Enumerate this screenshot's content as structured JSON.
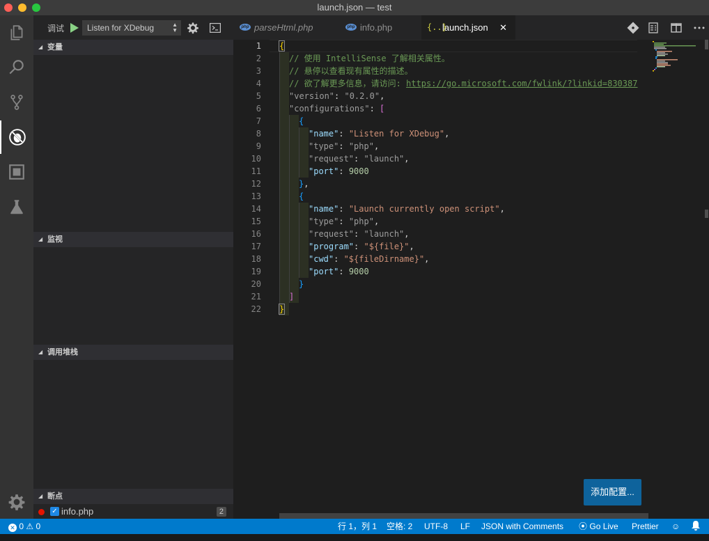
{
  "window": {
    "title": "launch.json — test"
  },
  "activity_bar": {
    "items": [
      "files-icon",
      "search-icon",
      "source-control-icon",
      "debug-icon",
      "extensions-icon",
      "test-flask-icon"
    ],
    "active": "debug-icon",
    "bottom": "gear-icon"
  },
  "sidebar": {
    "debug_label": "调试",
    "configuration": "Listen for XDebug",
    "sections": {
      "variables": "变量",
      "watch": "监视",
      "call_stack": "调用堆栈",
      "breakpoints": "断点"
    },
    "breakpoints": [
      {
        "file": "info.php",
        "count": "2",
        "enabled": true
      }
    ]
  },
  "tabs": [
    {
      "label": "parseHtml.php",
      "icon": "php-icon",
      "active": false
    },
    {
      "label": "info.php",
      "icon": "php-icon",
      "active": false
    },
    {
      "label": "launch.json",
      "icon": "json-braces-icon",
      "active": true
    }
  ],
  "tab_actions": [
    "open-changes-icon",
    "open-preview-icon",
    "split-editor-icon",
    "more-actions-icon"
  ],
  "editor": {
    "line_numbers": [
      "1",
      "2",
      "3",
      "4",
      "5",
      "6",
      "7",
      "8",
      "9",
      "10",
      "11",
      "12",
      "13",
      "14",
      "15",
      "16",
      "17",
      "18",
      "19",
      "20",
      "21",
      "22"
    ],
    "current_line": "1",
    "code": {
      "l1_brace": "{",
      "l2_comment": "// 使用 IntelliSense 了解相关属性。",
      "l3_comment": "// 悬停以查看现有属性的描述。",
      "l4_comment": "// 欲了解更多信息，请访问: ",
      "l4_link": "https://go.microsoft.com/fwlink/?linkid=830387",
      "l5_key": "\"version\"",
      "l5_val": "\"0.2.0\"",
      "l6_key": "\"configurations\"",
      "l6_bracket": "[",
      "l7_brace": "{",
      "l8_key": "\"name\"",
      "l8_val": "\"Listen for XDebug\"",
      "l9_key": "\"type\"",
      "l9_val": "\"php\"",
      "l10_key": "\"request\"",
      "l10_val": "\"launch\"",
      "l11_key": "\"port\"",
      "l11_val": "9000",
      "l12_brace": "}",
      "l13_brace": "{",
      "l14_key": "\"name\"",
      "l14_val": "\"Launch currently open script\"",
      "l15_key": "\"type\"",
      "l15_val": "\"php\"",
      "l16_key": "\"request\"",
      "l16_val": "\"launch\"",
      "l17_key": "\"program\"",
      "l17_val": "\"${file}\"",
      "l18_key": "\"cwd\"",
      "l18_val": "\"${fileDirname}\"",
      "l19_key": "\"port\"",
      "l19_val": "9000",
      "l20_brace": "}",
      "l21_bracket": "]",
      "l22_brace": "}"
    },
    "add_config_button": "添加配置..."
  },
  "statusbar": {
    "errors": "0",
    "warnings": "0",
    "position": "行 1，列 1",
    "indent": "空格: 2",
    "encoding": "UTF-8",
    "eol": "LF",
    "language": "JSON with Comments",
    "live_server": "Go Live",
    "formatter": "Prettier"
  },
  "colors": {
    "accent": "#007acc",
    "button": "#0e639c",
    "breakpoint": "#e51400"
  }
}
